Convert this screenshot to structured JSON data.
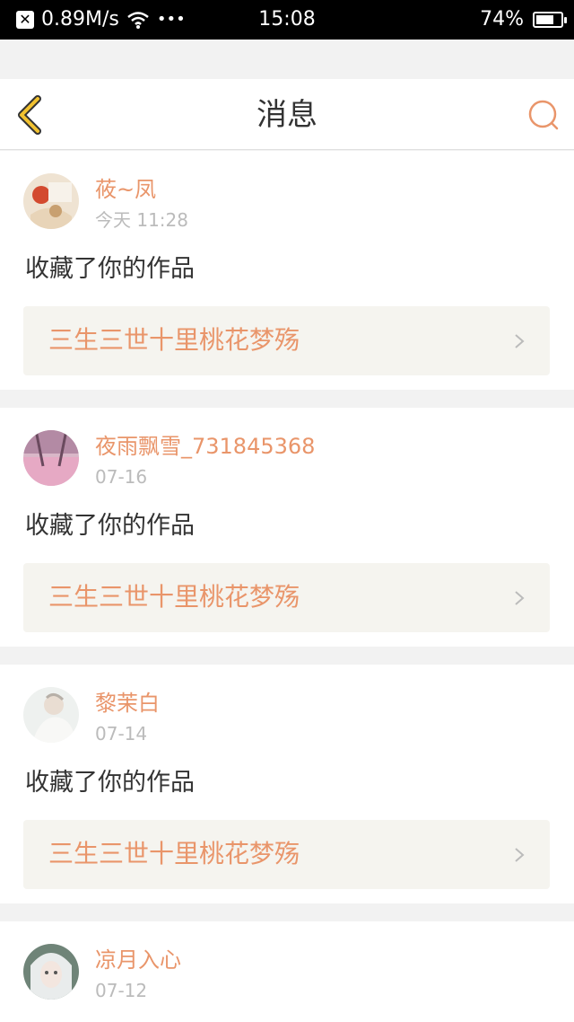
{
  "status_bar": {
    "speed": "0.89M/s",
    "dots": "•••",
    "time": "15:08",
    "battery": "74%",
    "battery_level": 0.74
  },
  "header": {
    "title": "消息"
  },
  "messages": [
    {
      "name": "莜~凤",
      "date": "今天 11:28",
      "action": "收藏了你的作品",
      "work_title": "三生三世十里桃花梦殇"
    },
    {
      "name": "夜雨飘雪_731845368",
      "date": "07-16",
      "action": "收藏了你的作品",
      "work_title": "三生三世十里桃花梦殇"
    },
    {
      "name": "黎茉白",
      "date": "07-14",
      "action": "收藏了你的作品",
      "work_title": "三生三世十里桃花梦殇"
    },
    {
      "name": "凉月入心",
      "date": "07-12"
    }
  ],
  "colors": {
    "accent": "#e9956a",
    "back_arrow": "#f2c230",
    "background": "#f2f2f2"
  }
}
